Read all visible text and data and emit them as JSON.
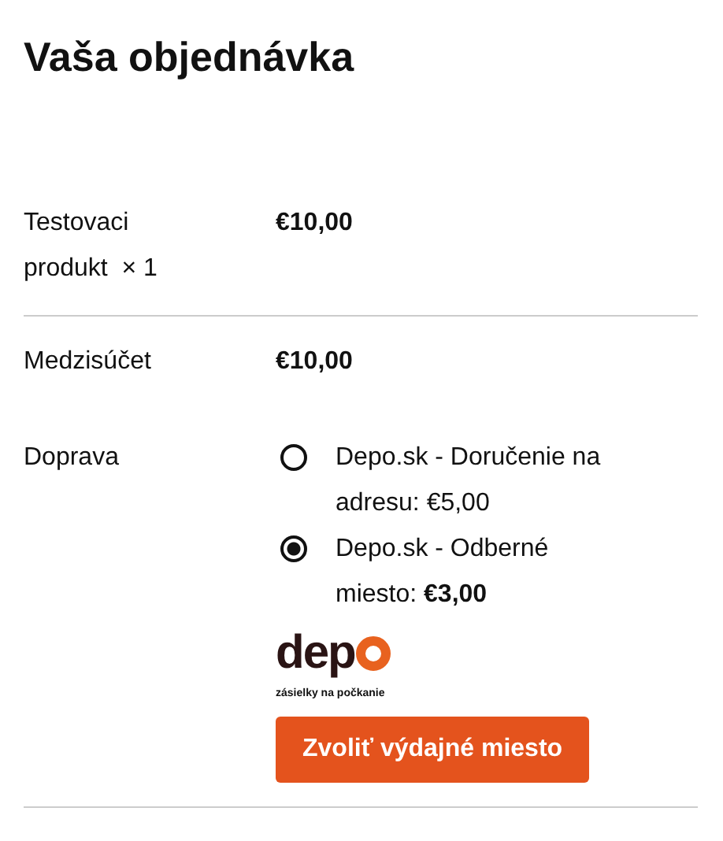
{
  "title": "Vaša objednávka",
  "product": {
    "name": "Testovaci produkt",
    "quantity": "× 1",
    "price": "€10,00"
  },
  "subtotal": {
    "label": "Medzisúčet",
    "value": "€10,00"
  },
  "shipping": {
    "label": "Doprava",
    "options": [
      {
        "label": "Depo.sk - Doručenie na adresu: €5,00",
        "selected": false
      },
      {
        "label": "Depo.sk - Odberné miesto: **€3,00**",
        "selected": true
      }
    ],
    "logo": {
      "word": "dep",
      "tagline": "zásielky na počkanie"
    },
    "button": "Zvoliť výdajné miesto"
  }
}
